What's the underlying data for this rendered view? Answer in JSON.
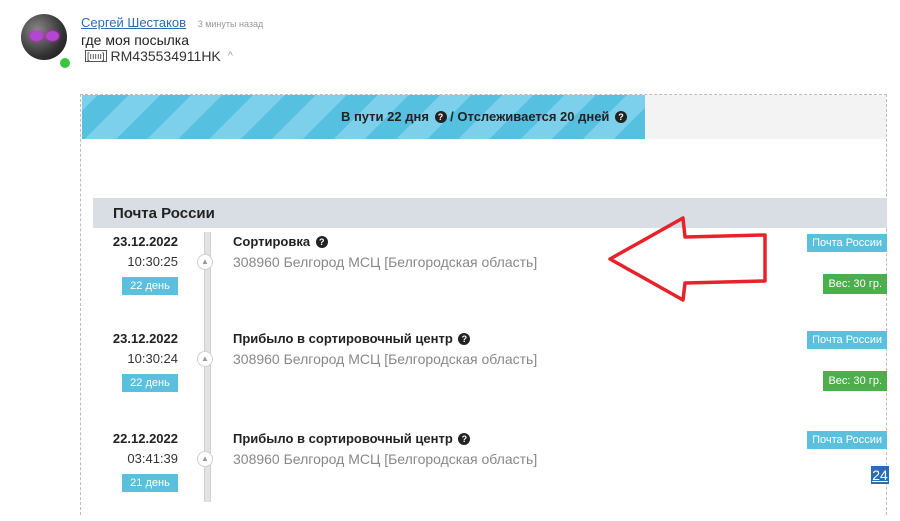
{
  "post": {
    "author": "Сергей Шестаков",
    "time_ago": "3 минуты назад",
    "message": "где моя посылка",
    "barcode_icon_text": "[ııııı]",
    "tracking_number": "RM435534911HK",
    "caret": "^"
  },
  "tracking": {
    "progress_fraction": 0.7,
    "status_in_transit": "В пути 22 дня",
    "separator": " / ",
    "status_tracked": "Отслеживается 20 дней",
    "help_icon": "?",
    "carrier": "Почта России",
    "page_badge": "24",
    "events": [
      {
        "date": "23.12.2022",
        "time": "10:30:25",
        "day": "22 день",
        "title": "Сортировка",
        "address": "308960 Белгород МСЦ [Белгородская область]",
        "carrier_tag": "Почта России",
        "weight": "Вес: 30 гр."
      },
      {
        "date": "23.12.2022",
        "time": "10:30:24",
        "day": "22 день",
        "title": "Прибыло в сортировочный центр",
        "address": "308960 Белгород МСЦ [Белгородская область]",
        "carrier_tag": "Почта России",
        "weight": "Вес: 30 гр."
      },
      {
        "date": "22.12.2022",
        "time": "03:41:39",
        "day": "21 день",
        "title": "Прибыло в сортировочный центр",
        "address": "308960 Белгород МСЦ [Белгородская область]",
        "carrier_tag": "Почта России"
      }
    ]
  },
  "colors": {
    "accent_blue": "#5bc0de",
    "weight_green": "#4cae4c",
    "annotation_red": "#e8222a",
    "link_blue": "#2a6db0"
  }
}
